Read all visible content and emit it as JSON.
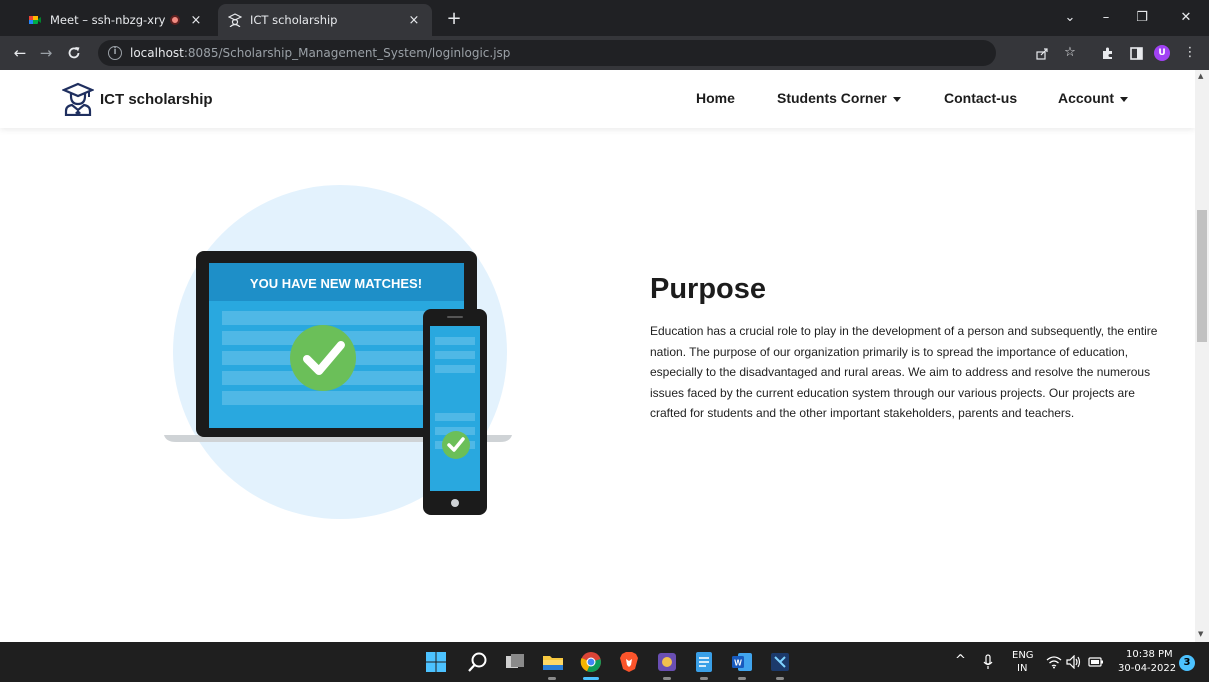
{
  "browser": {
    "tabs": [
      {
        "title": "Meet – ssh-nbzg-xry",
        "close": "×"
      },
      {
        "title": "ICT scholarship",
        "close": "×"
      }
    ],
    "new_tab": "+",
    "window_controls": {
      "list": "⌄",
      "minimize": "–",
      "restore": "❐",
      "close": "✕"
    },
    "url": {
      "host": "localhost",
      "path": ":8085/Scholarship_Management_System/loginlogic.jsp"
    },
    "avatar_letter": "U"
  },
  "site": {
    "brand": "ICT scholarship",
    "nav": [
      {
        "label": "Home"
      },
      {
        "label": "Students Corner"
      },
      {
        "label": "Contact-us"
      },
      {
        "label": "Account"
      }
    ],
    "illustration_caption": "YOU HAVE NEW MATCHES!",
    "purpose_title": "Purpose",
    "purpose_text": "Education has a crucial role to play in the development of a person and subsequently, the entire nation. The purpose of our organization primarily is to spread the importance of education, especially to the disadvantaged and rural areas. We aim to address and resolve the numerous issues faced by the current education system through our various projects. Our projects are crafted for students and the other important stakeholders, parents and teachers."
  },
  "taskbar": {
    "lang_top": "ENG",
    "lang_bottom": "IN",
    "time": "10:38 PM",
    "date": "30-04-2022",
    "notifications": "3"
  },
  "colors": {
    "chrome_dark": "#202124",
    "chrome_toolbar": "#35363a",
    "illustration_circle": "#e3f2fd",
    "screen_blue": "#29a8df",
    "check_green": "#6bbf59"
  }
}
